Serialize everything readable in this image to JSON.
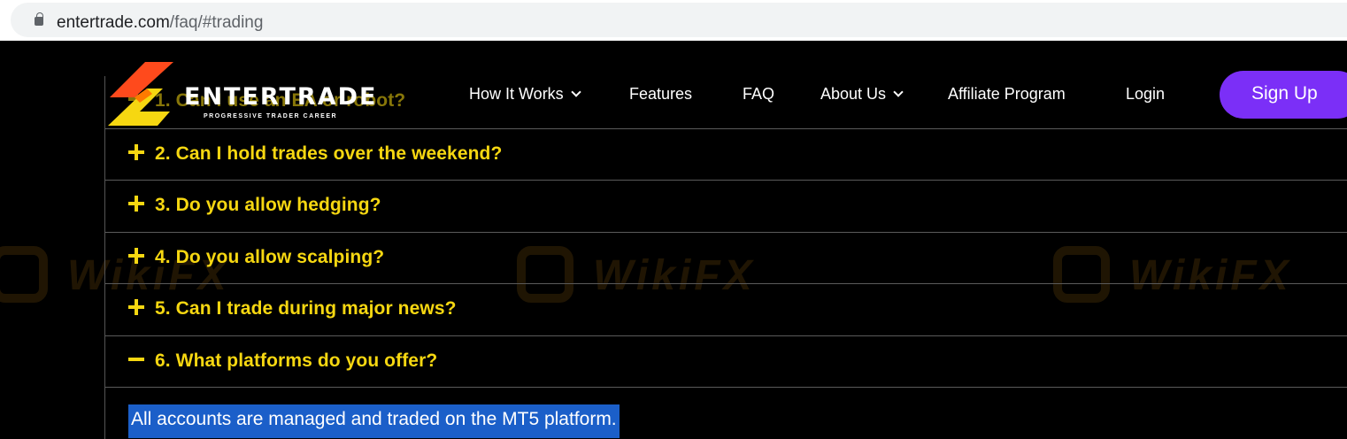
{
  "browser": {
    "url_domain": "entertrade.com",
    "url_path": "/faq/#trading"
  },
  "brand": {
    "name": "ENTERTRADE",
    "tagline": "PROGRESSIVE TRADER CAREER"
  },
  "nav": {
    "items": [
      {
        "label": "How It Works",
        "has_dropdown": true
      },
      {
        "label": "Features",
        "has_dropdown": false
      },
      {
        "label": "FAQ",
        "has_dropdown": false
      },
      {
        "label": "About Us",
        "has_dropdown": true
      },
      {
        "label": "Affiliate Program",
        "has_dropdown": false
      },
      {
        "label": "Login",
        "has_dropdown": false
      }
    ],
    "signup_label": "Sign Up"
  },
  "faq": {
    "items": [
      {
        "question": "1. Can I use an EA or robot?",
        "expanded": false
      },
      {
        "question": "2. Can I hold trades over the weekend?",
        "expanded": false
      },
      {
        "question": "3. Do you allow hedging?",
        "expanded": false
      },
      {
        "question": "4. Do you allow scalping?",
        "expanded": false
      },
      {
        "question": "5. Can I trade during major news?",
        "expanded": false
      },
      {
        "question": "6. What platforms do you offer?",
        "expanded": true
      }
    ],
    "answer": "All accounts are managed and traded on the MT5 platform."
  },
  "watermark": {
    "text": "WikiFX"
  },
  "colors": {
    "accent_yellow": "#f6d711",
    "signup_purple": "#7b2ff7",
    "selection_blue": "#1b5fc9",
    "background": "#000000"
  }
}
